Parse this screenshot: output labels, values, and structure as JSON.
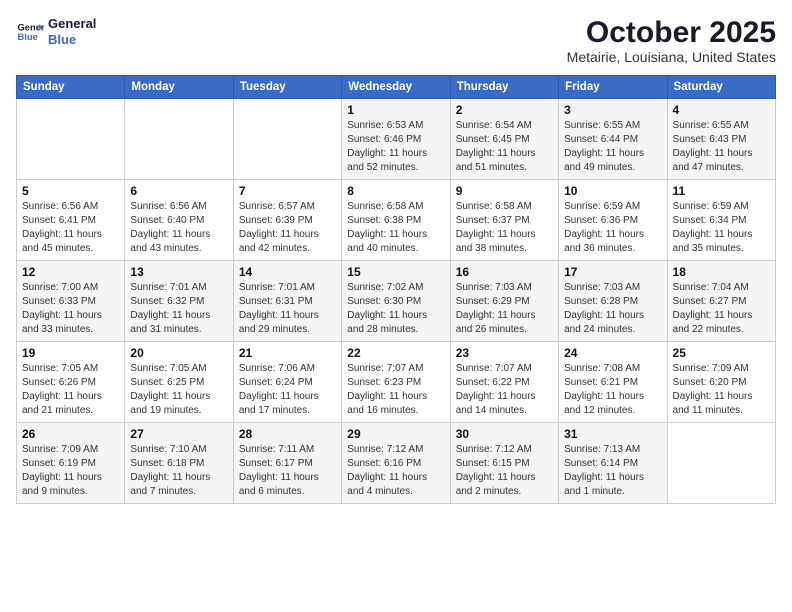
{
  "logo": {
    "line1": "General",
    "line2": "Blue"
  },
  "title": "October 2025",
  "location": "Metairie, Louisiana, United States",
  "days_of_week": [
    "Sunday",
    "Monday",
    "Tuesday",
    "Wednesday",
    "Thursday",
    "Friday",
    "Saturday"
  ],
  "weeks": [
    [
      {
        "day": "",
        "info": ""
      },
      {
        "day": "",
        "info": ""
      },
      {
        "day": "",
        "info": ""
      },
      {
        "day": "1",
        "info": "Sunrise: 6:53 AM\nSunset: 6:46 PM\nDaylight: 11 hours\nand 52 minutes."
      },
      {
        "day": "2",
        "info": "Sunrise: 6:54 AM\nSunset: 6:45 PM\nDaylight: 11 hours\nand 51 minutes."
      },
      {
        "day": "3",
        "info": "Sunrise: 6:55 AM\nSunset: 6:44 PM\nDaylight: 11 hours\nand 49 minutes."
      },
      {
        "day": "4",
        "info": "Sunrise: 6:55 AM\nSunset: 6:43 PM\nDaylight: 11 hours\nand 47 minutes."
      }
    ],
    [
      {
        "day": "5",
        "info": "Sunrise: 6:56 AM\nSunset: 6:41 PM\nDaylight: 11 hours\nand 45 minutes."
      },
      {
        "day": "6",
        "info": "Sunrise: 6:56 AM\nSunset: 6:40 PM\nDaylight: 11 hours\nand 43 minutes."
      },
      {
        "day": "7",
        "info": "Sunrise: 6:57 AM\nSunset: 6:39 PM\nDaylight: 11 hours\nand 42 minutes."
      },
      {
        "day": "8",
        "info": "Sunrise: 6:58 AM\nSunset: 6:38 PM\nDaylight: 11 hours\nand 40 minutes."
      },
      {
        "day": "9",
        "info": "Sunrise: 6:58 AM\nSunset: 6:37 PM\nDaylight: 11 hours\nand 38 minutes."
      },
      {
        "day": "10",
        "info": "Sunrise: 6:59 AM\nSunset: 6:36 PM\nDaylight: 11 hours\nand 36 minutes."
      },
      {
        "day": "11",
        "info": "Sunrise: 6:59 AM\nSunset: 6:34 PM\nDaylight: 11 hours\nand 35 minutes."
      }
    ],
    [
      {
        "day": "12",
        "info": "Sunrise: 7:00 AM\nSunset: 6:33 PM\nDaylight: 11 hours\nand 33 minutes."
      },
      {
        "day": "13",
        "info": "Sunrise: 7:01 AM\nSunset: 6:32 PM\nDaylight: 11 hours\nand 31 minutes."
      },
      {
        "day": "14",
        "info": "Sunrise: 7:01 AM\nSunset: 6:31 PM\nDaylight: 11 hours\nand 29 minutes."
      },
      {
        "day": "15",
        "info": "Sunrise: 7:02 AM\nSunset: 6:30 PM\nDaylight: 11 hours\nand 28 minutes."
      },
      {
        "day": "16",
        "info": "Sunrise: 7:03 AM\nSunset: 6:29 PM\nDaylight: 11 hours\nand 26 minutes."
      },
      {
        "day": "17",
        "info": "Sunrise: 7:03 AM\nSunset: 6:28 PM\nDaylight: 11 hours\nand 24 minutes."
      },
      {
        "day": "18",
        "info": "Sunrise: 7:04 AM\nSunset: 6:27 PM\nDaylight: 11 hours\nand 22 minutes."
      }
    ],
    [
      {
        "day": "19",
        "info": "Sunrise: 7:05 AM\nSunset: 6:26 PM\nDaylight: 11 hours\nand 21 minutes."
      },
      {
        "day": "20",
        "info": "Sunrise: 7:05 AM\nSunset: 6:25 PM\nDaylight: 11 hours\nand 19 minutes."
      },
      {
        "day": "21",
        "info": "Sunrise: 7:06 AM\nSunset: 6:24 PM\nDaylight: 11 hours\nand 17 minutes."
      },
      {
        "day": "22",
        "info": "Sunrise: 7:07 AM\nSunset: 6:23 PM\nDaylight: 11 hours\nand 16 minutes."
      },
      {
        "day": "23",
        "info": "Sunrise: 7:07 AM\nSunset: 6:22 PM\nDaylight: 11 hours\nand 14 minutes."
      },
      {
        "day": "24",
        "info": "Sunrise: 7:08 AM\nSunset: 6:21 PM\nDaylight: 11 hours\nand 12 minutes."
      },
      {
        "day": "25",
        "info": "Sunrise: 7:09 AM\nSunset: 6:20 PM\nDaylight: 11 hours\nand 11 minutes."
      }
    ],
    [
      {
        "day": "26",
        "info": "Sunrise: 7:09 AM\nSunset: 6:19 PM\nDaylight: 11 hours\nand 9 minutes."
      },
      {
        "day": "27",
        "info": "Sunrise: 7:10 AM\nSunset: 6:18 PM\nDaylight: 11 hours\nand 7 minutes."
      },
      {
        "day": "28",
        "info": "Sunrise: 7:11 AM\nSunset: 6:17 PM\nDaylight: 11 hours\nand 6 minutes."
      },
      {
        "day": "29",
        "info": "Sunrise: 7:12 AM\nSunset: 6:16 PM\nDaylight: 11 hours\nand 4 minutes."
      },
      {
        "day": "30",
        "info": "Sunrise: 7:12 AM\nSunset: 6:15 PM\nDaylight: 11 hours\nand 2 minutes."
      },
      {
        "day": "31",
        "info": "Sunrise: 7:13 AM\nSunset: 6:14 PM\nDaylight: 11 hours\nand 1 minute."
      },
      {
        "day": "",
        "info": ""
      }
    ]
  ]
}
